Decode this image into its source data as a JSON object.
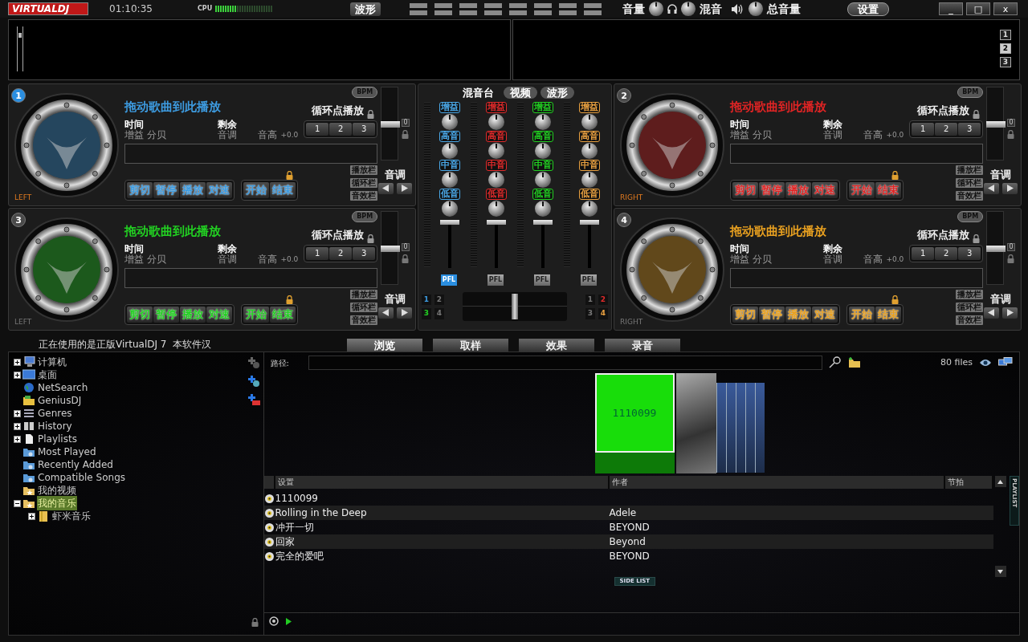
{
  "topbar": {
    "logo": "VIRTUALDJ",
    "time": "01:10:35",
    "cpu_label": "CPU",
    "cpu": {
      "level": 0.36
    },
    "view_button": "波形",
    "volume_label": "音量",
    "mix_label": "混音",
    "master_label": "总音量",
    "settings_button": "设置",
    "window_buttons": [
      "_",
      "□",
      "x"
    ]
  },
  "waveform": {
    "zoom": {
      "level": 0.85
    },
    "deck_buttons": [
      {
        "label": "1",
        "selected": false
      },
      {
        "label": "2",
        "selected": true
      },
      {
        "label": "3",
        "selected": false
      }
    ]
  },
  "left_decks": [
    {
      "number": "1",
      "selected": true,
      "active": true,
      "color": "#3d9be0",
      "side": "LEFT",
      "title": "拖动歌曲到此播放",
      "time_label": "时间",
      "gain_label": "增益 分贝",
      "remain_label": "剩余",
      "key_label": "音调",
      "pitch_label": "音高",
      "pitch_value": "+0.0",
      "bpm_button": "BPM",
      "loop_label": "循环点播放",
      "loop_buttons": [
        "1",
        "2",
        "3"
      ],
      "transport": [
        "剪切",
        "暂停",
        "播放",
        "对速"
      ],
      "cue_buttons": [
        "开始",
        "结束"
      ],
      "panel_buttons": [
        "播放栏",
        "循环栏",
        "音效栏"
      ],
      "pitch_title": "音调",
      "pitch_reset": "0",
      "pitch": {
        "level": 0.5
      }
    },
    {
      "number": "3",
      "selected": false,
      "active": false,
      "color": "#22d022",
      "side": "LEFT",
      "title": "拖动歌曲到此播放",
      "time_label": "时间",
      "gain_label": "增益 分贝",
      "remain_label": "剩余",
      "key_label": "音调",
      "pitch_label": "音高",
      "pitch_value": "+0.0",
      "bpm_button": "BPM",
      "loop_label": "循环点播放",
      "loop_buttons": [
        "1",
        "2",
        "3"
      ],
      "transport": [
        "剪切",
        "暂停",
        "播放",
        "对速"
      ],
      "cue_buttons": [
        "开始",
        "结束"
      ],
      "panel_buttons": [
        "播放栏",
        "循环栏",
        "音效栏"
      ],
      "pitch_title": "音调",
      "pitch_reset": "0",
      "pitch": {
        "level": 0.5
      }
    }
  ],
  "mixer": {
    "tabs": [
      {
        "label": "混音台",
        "selected": true
      },
      {
        "label": "视频",
        "selected": false
      },
      {
        "label": "波形",
        "selected": false
      }
    ],
    "channels": [
      {
        "color": "#4aa8e8",
        "knob_labels": [
          "增益",
          "高音",
          "中音",
          "低音"
        ],
        "pfl": "PFL",
        "pfl_on": true,
        "volume": {
          "level": 1
        }
      },
      {
        "color": "#e02a2a",
        "knob_labels": [
          "增益",
          "高音",
          "中音",
          "低音"
        ],
        "pfl": "PFL",
        "pfl_on": false,
        "volume": {
          "level": 1
        }
      },
      {
        "color": "#22d022",
        "knob_labels": [
          "增益",
          "高音",
          "中音",
          "低音"
        ],
        "pfl": "PFL",
        "pfl_on": false,
        "volume": {
          "level": 1
        }
      },
      {
        "color": "#e8a040",
        "knob_labels": [
          "增益",
          "高音",
          "中音",
          "低音"
        ],
        "pfl": "PFL",
        "pfl_on": false,
        "volume": {
          "level": 1
        }
      }
    ],
    "crossfader": {
      "level": 0.5,
      "left": [
        {
          "label": "1",
          "assigned": true,
          "color": "#3d9be0"
        },
        {
          "label": "2",
          "assigned": false
        },
        {
          "label": "3",
          "assigned": true,
          "color": "#22d022"
        },
        {
          "label": "4",
          "assigned": false
        }
      ],
      "right": [
        {
          "label": "1",
          "assigned": false
        },
        {
          "label": "2",
          "assigned": true,
          "color": "#e02a2a"
        },
        {
          "label": "3",
          "assigned": false
        },
        {
          "label": "4",
          "assigned": true,
          "color": "#e8a040"
        }
      ]
    }
  },
  "right_decks": [
    {
      "number": "2",
      "selected": false,
      "active": true,
      "color": "#e02424",
      "side": "RIGHT",
      "title": "拖动歌曲到此播放",
      "time_label": "时间",
      "gain_label": "增益 分贝",
      "remain_label": "剩余",
      "key_label": "音调",
      "pitch_label": "音高",
      "pitch_value": "+0.0",
      "bpm_button": "BPM",
      "loop_label": "循环点播放",
      "loop_buttons": [
        "1",
        "2",
        "3"
      ],
      "transport": [
        "剪切",
        "暂停",
        "播放",
        "对速"
      ],
      "cue_buttons": [
        "开始",
        "结束"
      ],
      "panel_buttons": [
        "播放栏",
        "循环栏",
        "音效栏"
      ],
      "pitch_title": "音调",
      "pitch_reset": "0",
      "pitch": {
        "level": 0.5
      }
    },
    {
      "number": "4",
      "selected": false,
      "active": false,
      "color": "#e8a020",
      "side": "RIGHT",
      "title": "拖动歌曲到此播放",
      "time_label": "时间",
      "gain_label": "增益 分贝",
      "remain_label": "剩余",
      "key_label": "音调",
      "pitch_label": "音高",
      "pitch_value": "+0.0",
      "bpm_button": "BPM",
      "loop_label": "循环点播放",
      "loop_buttons": [
        "1",
        "2",
        "3"
      ],
      "transport": [
        "剪切",
        "暂停",
        "播放",
        "对速"
      ],
      "cue_buttons": [
        "开始",
        "结束"
      ],
      "panel_buttons": [
        "播放栏",
        "循环栏",
        "音效栏"
      ],
      "pitch_title": "音调",
      "pitch_reset": "0",
      "pitch": {
        "level": 0.5
      }
    }
  ],
  "status_text": "正在使用的是正版VirtualDJ 7  本软件汉",
  "browser_tabs": [
    {
      "label": "浏览",
      "selected": true
    },
    {
      "label": "取样",
      "selected": false
    },
    {
      "label": "效果",
      "selected": false
    },
    {
      "label": "录音",
      "selected": false
    }
  ],
  "tree": [
    {
      "label": "计算机",
      "kind": "computer",
      "expanded": false,
      "selected": false
    },
    {
      "label": "桌面",
      "kind": "desktop",
      "expanded": false,
      "selected": false
    },
    {
      "label": "NetSearch",
      "kind": "globe",
      "selected": false
    },
    {
      "label": "GeniusDJ",
      "kind": "folder",
      "selected": false
    },
    {
      "label": "Genres",
      "kind": "stack",
      "expanded": false,
      "selected": false
    },
    {
      "label": "History",
      "kind": "book",
      "expanded": false,
      "selected": false
    },
    {
      "label": "Playlists",
      "kind": "page",
      "expanded": false,
      "selected": false
    },
    {
      "label": "Most Played",
      "kind": "smart",
      "selected": false
    },
    {
      "label": "Recently Added",
      "kind": "smart",
      "selected": false
    },
    {
      "label": "Compatible Songs",
      "kind": "smart",
      "selected": false
    },
    {
      "label": "我的视频",
      "kind": "star",
      "selected": false
    },
    {
      "label": "我的音乐",
      "kind": "star",
      "expanded": true,
      "selected": true,
      "children": [
        {
          "label": "虾米音乐",
          "kind": "book-folder",
          "expanded": false,
          "selected": false
        }
      ]
    }
  ],
  "browser": {
    "path_label": "路径:",
    "files": "80 files",
    "covers": [
      {
        "kind": "text",
        "label": "1110099"
      },
      {
        "kind": "photo"
      },
      {
        "kind": "slice"
      },
      {
        "kind": "slice"
      },
      {
        "kind": "slice"
      },
      {
        "kind": "slice"
      },
      {
        "kind": "slice"
      }
    ],
    "columns": [
      "设置",
      "作者",
      "节拍"
    ],
    "rows": [
      {
        "title": "1110099"
      },
      {
        "title": "Rolling in the Deep",
        "artist": "Adele"
      },
      {
        "title": "冲开一切",
        "artist": "BEYOND"
      },
      {
        "title": "回家",
        "artist": "Beyond"
      },
      {
        "title": "完全的爱吧",
        "artist": "BEYOND"
      }
    ],
    "side_list": "SIDE LIST",
    "playlist_tab": "PLAYLIST"
  }
}
